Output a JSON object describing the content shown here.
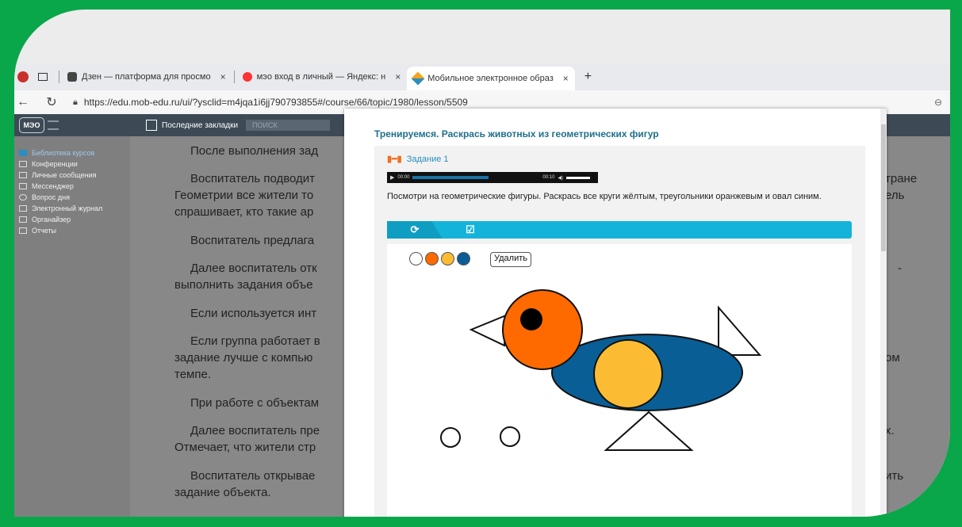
{
  "browser": {
    "tabs": [
      {
        "label": "Дзен — платформа для просмо",
        "active": false
      },
      {
        "label": "мэо вход в личный — Яндекс: н",
        "active": false
      },
      {
        "label": "Мобильное электронное образ",
        "active": true
      }
    ],
    "new_tab_label": "+",
    "close_glyph": "×",
    "url": "https://edu.mob-edu.ru/ui/?ysclid=m4jqa1i6jj790793855#/course/66/topic/1980/lesson/5509"
  },
  "app": {
    "logo": "МЭО",
    "bookmarks_label": "Последние закладки",
    "search_placeholder": "ПОИСК",
    "sidebar": [
      {
        "label": "Библиотека курсов",
        "icon": "book-icon",
        "active": true
      },
      {
        "label": "Конференции",
        "icon": "video-icon",
        "active": false
      },
      {
        "label": "Личные сообщения",
        "icon": "mail-icon",
        "active": false
      },
      {
        "label": "Мессенджер",
        "icon": "chat-icon",
        "active": false
      },
      {
        "label": "Вопрос дня",
        "icon": "question-icon",
        "active": false
      },
      {
        "label": "Электронный журнал",
        "icon": "journal-icon",
        "active": false
      },
      {
        "label": "Органайзер",
        "icon": "calendar-icon",
        "active": false
      },
      {
        "label": "Отчеты",
        "icon": "report-icon",
        "active": false
      }
    ],
    "collapse_label": "«"
  },
  "lesson": {
    "paragraphs": [
      "После выполнения зад",
      "Воспитатель подводит",
      "Геометрии все жители то",
      "спрашивает, кто такие ар",
      "Воспитатель предлага",
      "Далее воспитатель отк",
      "выполнить задания объе",
      "Если используется инт",
      "Если группа работает в",
      "задание лучше с компью",
      "темпе.",
      "При работе с объектам",
      "Далее воспитатель пре",
      "Отмечает, что жители стр",
      "Воспитатель открывае",
      "задание объекта."
    ],
    "right_fragments": [
      "тране",
      "ель",
      "ом",
      "х.",
      "ить",
      "-"
    ]
  },
  "dialog": {
    "title": "Тренируемся. Раскрась животных из геометрических фигур",
    "task_label": "Задание 1",
    "audio": {
      "current": "00:00",
      "duration": "00:10"
    },
    "instruction": "Посмотри на геометрические фигуры. Раскрась все круги жёлтым, треугольники оранжевым и овал синим.",
    "delete_label": "Удалить",
    "palette": [
      "#ffffff",
      "#ff6a00",
      "#fbbc34",
      "#0a5e96"
    ],
    "colors": {
      "orange": "#ff6a00",
      "yellow": "#fbbc34",
      "blue": "#0a5e96",
      "accent": "#14b4da"
    }
  }
}
